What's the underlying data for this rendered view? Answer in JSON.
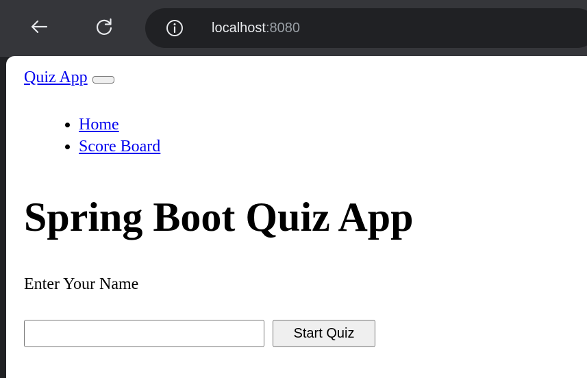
{
  "browser": {
    "url_host": "localhost",
    "url_port": ":8080",
    "icons": [
      "back-arrow-icon",
      "reload-icon",
      "info-icon"
    ]
  },
  "navbar": {
    "brand": "Quiz App",
    "items": [
      {
        "label": "Home"
      },
      {
        "label": "Score Board"
      }
    ]
  },
  "main": {
    "title": "Spring Boot Quiz App",
    "name_label": "Enter Your Name",
    "name_input_value": "",
    "start_button": "Start Quiz"
  },
  "colors": {
    "chrome_bg": "#35363a",
    "omnibox_bg": "#202124",
    "link": "#0000ee"
  }
}
